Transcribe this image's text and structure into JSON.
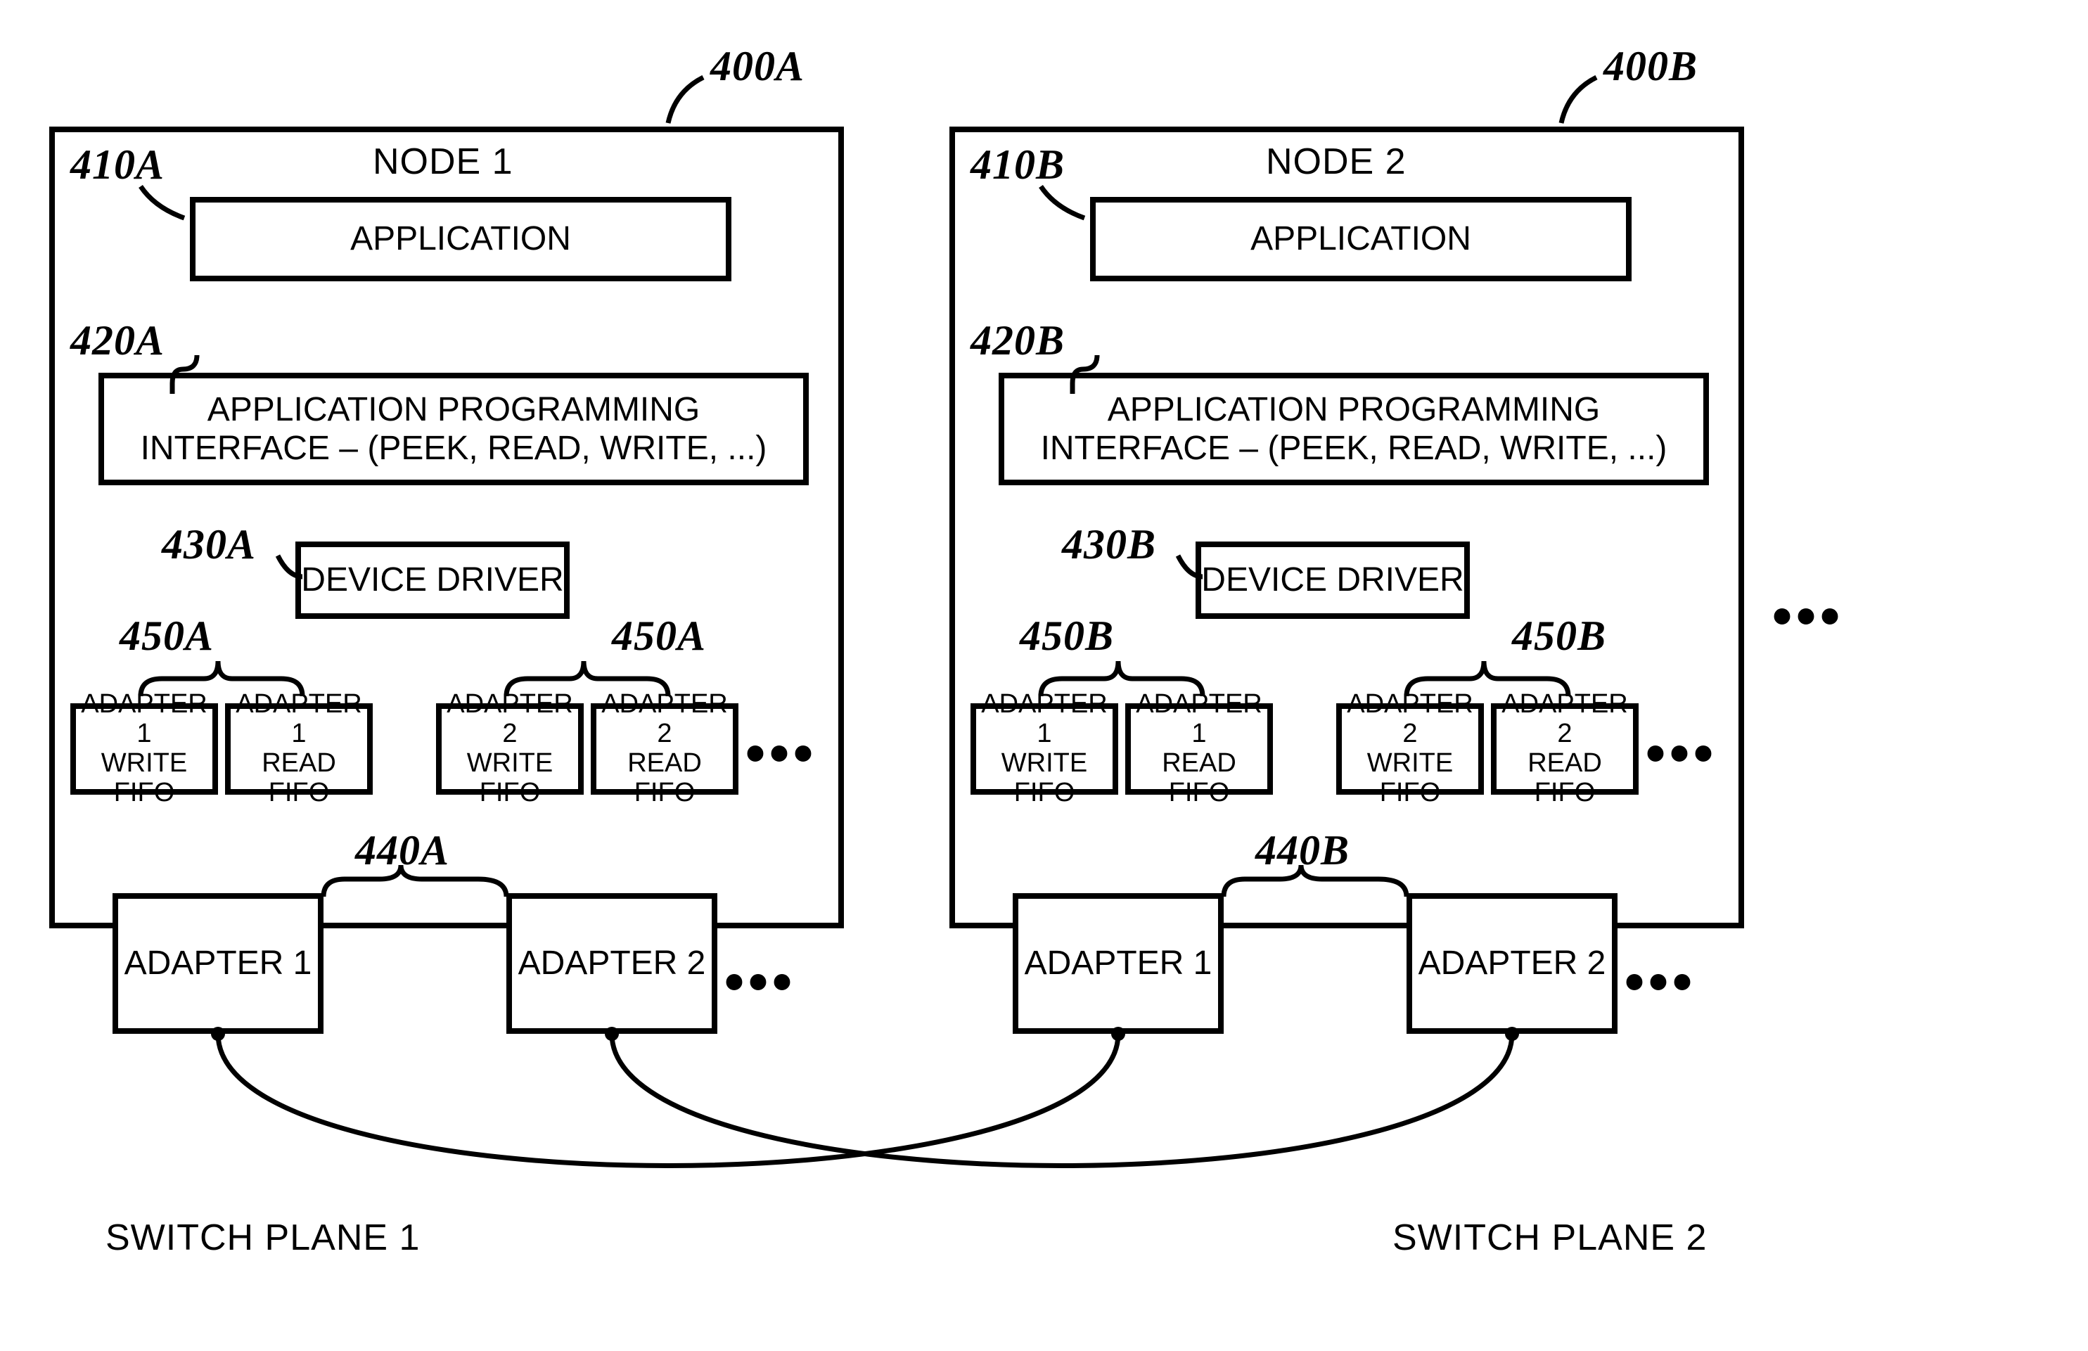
{
  "refs": {
    "n400A": "400A",
    "n400B": "400B",
    "n410A": "410A",
    "n410B": "410B",
    "n420A": "420A",
    "n420B": "420B",
    "n430A": "430A",
    "n430B": "430B",
    "n440A": "440A",
    "n440B": "440B",
    "n450A_left": "450A",
    "n450A_right": "450A",
    "n450B_left": "450B",
    "n450B_right": "450B"
  },
  "nodeA": {
    "title": "NODE 1",
    "application": "APPLICATION",
    "api_line1": "APPLICATION PROGRAMMING",
    "api_line2": "INTERFACE – (PEEK, READ, WRITE, ...)",
    "driver": "DEVICE DRIVER",
    "fifo1w_l1": "ADAPTER 1",
    "fifo1w_l2": "WRITE FIFO",
    "fifo1r_l1": "ADAPTER 1",
    "fifo1r_l2": "READ FIFO",
    "fifo2w_l1": "ADAPTER 2",
    "fifo2w_l2": "WRITE FIFO",
    "fifo2r_l1": "ADAPTER 2",
    "fifo2r_l2": "READ FIFO",
    "adapter1": "ADAPTER 1",
    "adapter2": "ADAPTER 2"
  },
  "nodeB": {
    "title": "NODE 2",
    "application": "APPLICATION",
    "api_line1": "APPLICATION PROGRAMMING",
    "api_line2": "INTERFACE – (PEEK, READ, WRITE, ...)",
    "driver": "DEVICE DRIVER",
    "fifo1w_l1": "ADAPTER 1",
    "fifo1w_l2": "WRITE FIFO",
    "fifo1r_l1": "ADAPTER 1",
    "fifo1r_l2": "READ FIFO",
    "fifo2w_l1": "ADAPTER 2",
    "fifo2w_l2": "WRITE FIFO",
    "fifo2r_l1": "ADAPTER 2",
    "fifo2r_l2": "READ FIFO",
    "adapter1": "ADAPTER 1",
    "adapter2": "ADAPTER 2"
  },
  "planes": {
    "p1": "SWITCH PLANE 1",
    "p2": "SWITCH PLANE 2"
  },
  "ellipsis": "•••"
}
